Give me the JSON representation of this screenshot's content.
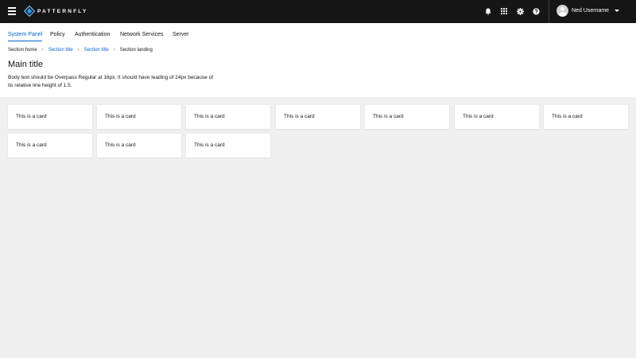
{
  "masthead": {
    "brand": "PATTERNFLY",
    "icons": [
      "bell-icon",
      "app-grid-icon",
      "gear-icon",
      "help-icon"
    ],
    "user_name": "Ned Username"
  },
  "nav": {
    "items": [
      {
        "label": "System Panel",
        "active": true
      },
      {
        "label": "Policy",
        "active": false
      },
      {
        "label": "Authentication",
        "active": false
      },
      {
        "label": "Network Services",
        "active": false
      },
      {
        "label": "Server",
        "active": false
      }
    ]
  },
  "breadcrumb": {
    "items": [
      {
        "label": "Section home",
        "link": false
      },
      {
        "label": "Section title",
        "link": true
      },
      {
        "label": "Section title",
        "link": true
      },
      {
        "label": "Section landing",
        "link": false
      }
    ]
  },
  "page": {
    "title": "Main title",
    "body": "Body text should be Overpass Regular at 16px. It should have leading of 24px because of its relative line height of 1.5."
  },
  "cards": [
    {
      "label": "This is a card"
    },
    {
      "label": "This is a card"
    },
    {
      "label": "This is a card"
    },
    {
      "label": "This is a card"
    },
    {
      "label": "This is a card"
    },
    {
      "label": "This is a card"
    },
    {
      "label": "This is a card"
    },
    {
      "label": "This is a card"
    },
    {
      "label": "This is a card"
    },
    {
      "label": "This is a card"
    }
  ],
  "colors": {
    "masthead_bg": "#151515",
    "accent": "#06c",
    "page_bg": "#f0f0f0"
  }
}
